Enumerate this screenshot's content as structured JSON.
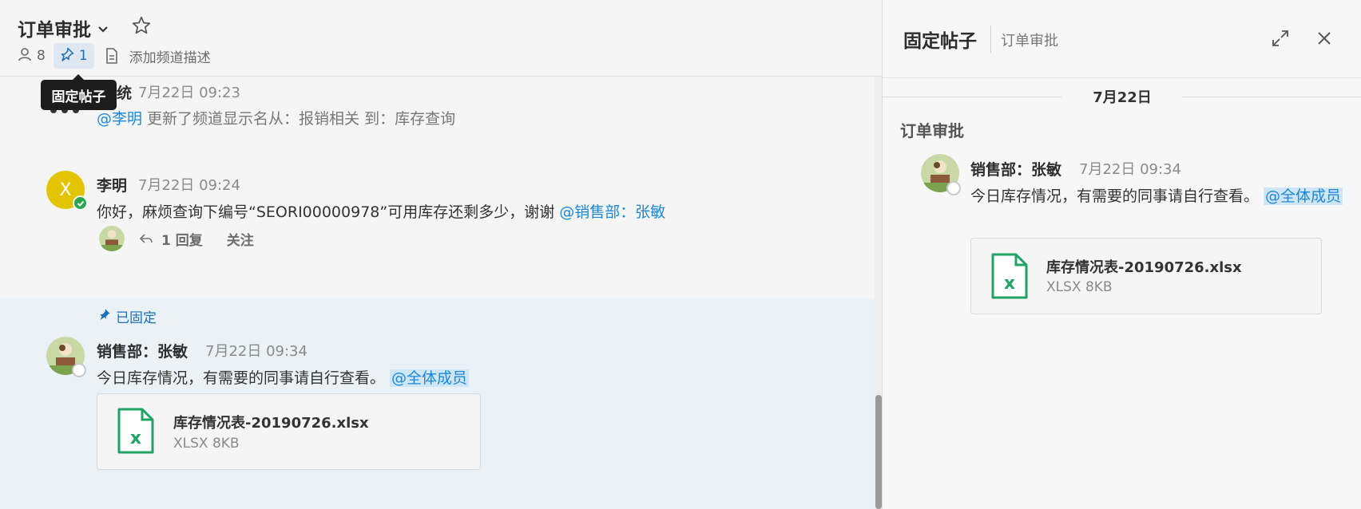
{
  "channel": {
    "title": "订单审批",
    "member_count": "8",
    "pin_count": "1",
    "add_description": "添加频道描述"
  },
  "tooltip": "固定帖子",
  "messages": {
    "system": {
      "name_fragment": "统",
      "time": "7月22日 09:23",
      "mention": "@李明",
      "text": " 更新了频道显示名从：报销相关 到：库存查询"
    },
    "liming": {
      "avatar_letter": "X",
      "name": "李明",
      "time": "7月22日 09:24",
      "text": "你好，麻烦查询下编号“SEORI00000978”可用库存还剩多少，谢谢 ",
      "mention": "@销售部：张敏",
      "reply_count": "1 回复",
      "follow": "关注"
    },
    "pinned": {
      "tag": "已固定",
      "name": "销售部：张敏",
      "time": "7月22日 09:34",
      "text": "今日库存情况，有需要的同事请自行查看。 ",
      "mention": "@全体成员",
      "file_name": "库存情况表-20190726.xlsx",
      "file_meta": "XLSX 8KB"
    }
  },
  "panel": {
    "title": "固定帖子",
    "subtitle": "订单审批",
    "date": "7月22日",
    "channel": "订单审批",
    "post": {
      "name": "销售部：张敏",
      "time": "7月22日 09:34",
      "text": "今日库存情况，有需要的同事请自行查看。 ",
      "mention": "@全体成员",
      "file_name": "库存情况表-20190726.xlsx",
      "file_meta": "XLSX 8KB"
    }
  },
  "icons": {
    "members": "user-icon",
    "pin": "pin-icon",
    "doc": "document-icon",
    "star": "star-icon",
    "chevron": "chevron-down-icon",
    "reply": "reply-icon",
    "expand": "expand-icon",
    "close": "close-icon",
    "file": "excel-file-icon"
  },
  "colors": {
    "accent": "#1d87d8",
    "pinned_bg": "#eaf1f7",
    "online": "#2ca54f",
    "excel": "#21a366",
    "avatar_yellow": "#e2c400"
  }
}
